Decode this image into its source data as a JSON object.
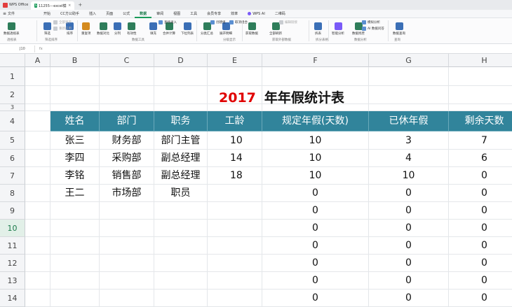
{
  "titlebar": {
    "app_name": "WPS Office",
    "doc_tab": "11255---excel模板-人力资源",
    "tab_icon": "S",
    "close": "×",
    "plus": "+"
  },
  "menubar": {
    "file": "文件",
    "items": [
      "开始",
      "CC方公助手",
      "插入",
      "页面",
      "公式",
      "数据",
      "审阅",
      "视图",
      "工具",
      "会员专享",
      "效率"
    ],
    "active": "数据",
    "ai": "WPS AI",
    "extra": "二维码"
  },
  "ribbon": {
    "buttons": [
      {
        "label": "数据透视表",
        "color": "#2e7d5a"
      },
      {
        "label": "筛选",
        "color": "#3b6fb6"
      },
      {
        "label": "排序",
        "color": "#3b6fb6"
      },
      {
        "label": "重复项",
        "color": "#d48a1e"
      },
      {
        "label": "数据对比",
        "color": "#2e7d5a"
      },
      {
        "label": "分列",
        "color": "#3b6fb6"
      },
      {
        "label": "有效性",
        "color": "#2e7d5a"
      },
      {
        "label": "填充",
        "color": "#3b6fb6"
      },
      {
        "label": "合并计算",
        "color": "#2e7d5a"
      },
      {
        "label": "下拉列表",
        "color": "#3b6fb6"
      },
      {
        "label": "分类汇总",
        "color": "#2e7d5a"
      },
      {
        "label": "展开明细",
        "color": "#3b6fb6"
      },
      {
        "label": "获取数据",
        "color": "#2e7d5a"
      },
      {
        "label": "全部刷新",
        "color": "#2e7d5a"
      },
      {
        "label": "拆表",
        "color": "#3b6fb6"
      },
      {
        "label": "智能分析",
        "color": "#7a5af8"
      },
      {
        "label": "数据找茬",
        "color": "#2e7d5a"
      },
      {
        "label": "数据查询",
        "color": "#3b6fb6"
      }
    ],
    "small": [
      {
        "label": "全部显示",
        "dim": true
      },
      {
        "label": "重新应用",
        "dim": true
      },
      {
        "label": "查找录入",
        "dim": false
      },
      {
        "label": "创建组",
        "dim": false
      },
      {
        "label": "取消组合",
        "dim": false
      },
      {
        "label": "编辑链接",
        "dim": true
      },
      {
        "label": "模拟分析",
        "dim": false
      },
      {
        "label": "AI 数据问答",
        "dim": false
      }
    ],
    "groups": [
      "透视表",
      "筛选排序",
      "数据工具",
      "分级显示",
      "获取外部数据",
      "拆分表格",
      "数据分析",
      "查询"
    ]
  },
  "formula_bar": {
    "name_box": "J10",
    "fx": "fx"
  },
  "sheet": {
    "columns": [
      "A",
      "B",
      "C",
      "D",
      "E",
      "F",
      "G",
      "H"
    ],
    "rows": [
      "1",
      "2",
      "3",
      "4",
      "5",
      "6",
      "7",
      "8",
      "9",
      "10",
      "11",
      "12",
      "13",
      "14"
    ],
    "title_year": "2017",
    "title_text": "年年假统计表",
    "headers": [
      "姓名",
      "部门",
      "职务",
      "工龄",
      "规定年假(天数)",
      "已休年假",
      "剩余天数"
    ],
    "data": [
      [
        "张三",
        "财务部",
        "部门主管",
        "10",
        "10",
        "3",
        "7"
      ],
      [
        "李四",
        "采购部",
        "副总经理",
        "14",
        "10",
        "4",
        "6"
      ],
      [
        "李铭",
        "销售部",
        "副总经理",
        "18",
        "10",
        "10",
        "0"
      ],
      [
        "王二",
        "市场部",
        "职员",
        "",
        "0",
        "0",
        "0"
      ],
      [
        "",
        "",
        "",
        "",
        "0",
        "0",
        "0"
      ],
      [
        "",
        "",
        "",
        "",
        "0",
        "0",
        "0"
      ],
      [
        "",
        "",
        "",
        "",
        "0",
        "0",
        "0"
      ],
      [
        "",
        "",
        "",
        "",
        "0",
        "0",
        "0"
      ],
      [
        "",
        "",
        "",
        "",
        "0",
        "0",
        "0"
      ],
      [
        "",
        "",
        "",
        "",
        "0",
        "0",
        "0"
      ]
    ]
  }
}
